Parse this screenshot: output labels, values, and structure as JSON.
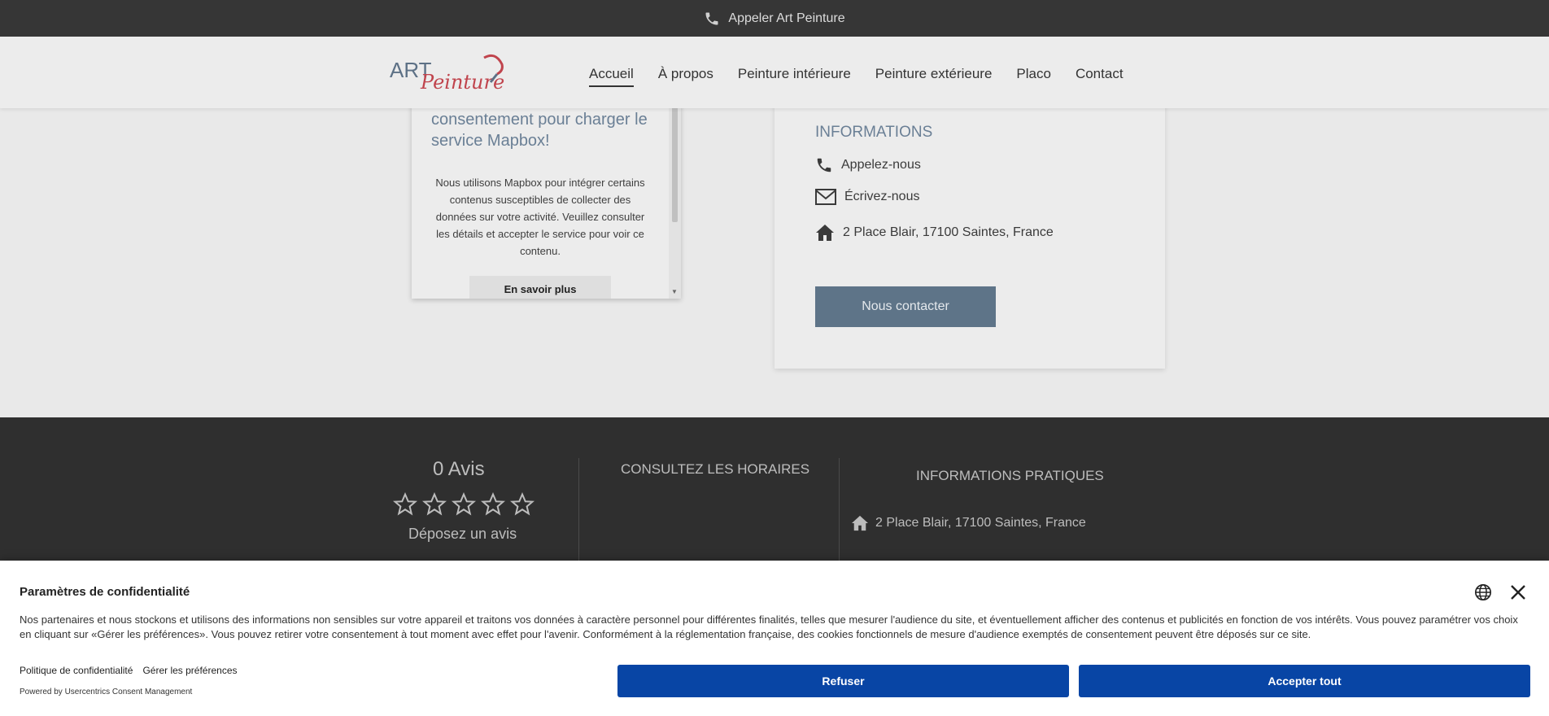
{
  "topbar": {
    "phone_label": "Appeler Art Peinture"
  },
  "logo": {
    "text_art": "ART",
    "text_peinture": "Peinture"
  },
  "nav": {
    "items": [
      {
        "label": "Accueil",
        "active": true
      },
      {
        "label": "À propos"
      },
      {
        "label": "Peinture intérieure"
      },
      {
        "label": "Peinture extérieure"
      },
      {
        "label": "Placo"
      },
      {
        "label": "Contact"
      }
    ]
  },
  "map_consent": {
    "heading": "consentement pour charger le service Mapbox!",
    "body": "Nous utilisons Mapbox pour intégrer certains contenus susceptibles de collecter des données sur votre activité. Veuillez consulter les détails et accepter le service pour voir ce contenu.",
    "learn_more": "En savoir plus"
  },
  "info": {
    "title": "INFORMATIONS",
    "call": "Appelez-nous",
    "write": "Écrivez-nous",
    "address": "2 Place Blair, 17100 Saintes, France",
    "contact_button": "Nous contacter"
  },
  "footer": {
    "avis_count": "0 Avis",
    "rating_stars": 0,
    "rating_max": 5,
    "deposez": "Déposez un avis",
    "horaires": "CONSULTEZ LES HORAIRES",
    "pratiques": "INFORMATIONS PRATIQUES",
    "address": "2 Place Blair, 17100 Saintes, France"
  },
  "cmp": {
    "title": "Paramètres de confidentialité",
    "text": "Nos partenaires et nous stockons et utilisons des informations non sensibles sur votre appareil et traitons vos données à caractère personnel pour différentes finalités, telles que mesurer l'audience du site, et éventuellement afficher des contenus et publicités en fonction de vos intérêts. Vous pouvez paramétrer vos choix en cliquant sur «Gérer les préférences». Vous pouvez retirer votre consentement à tout moment avec effet pour l'avenir. Conformément à la réglementation française, des cookies fonctionnels de mesure d'audience exemptés de consentement peuvent être déposés sur ce site.",
    "privacy_link": "Politique de confidentialité",
    "prefs_link": "Gérer les préférences",
    "powered": "Powered by Usercentrics Consent Management",
    "refuse": "Refuser",
    "accept": "Accepter tout",
    "button_color": "#0845a5"
  }
}
